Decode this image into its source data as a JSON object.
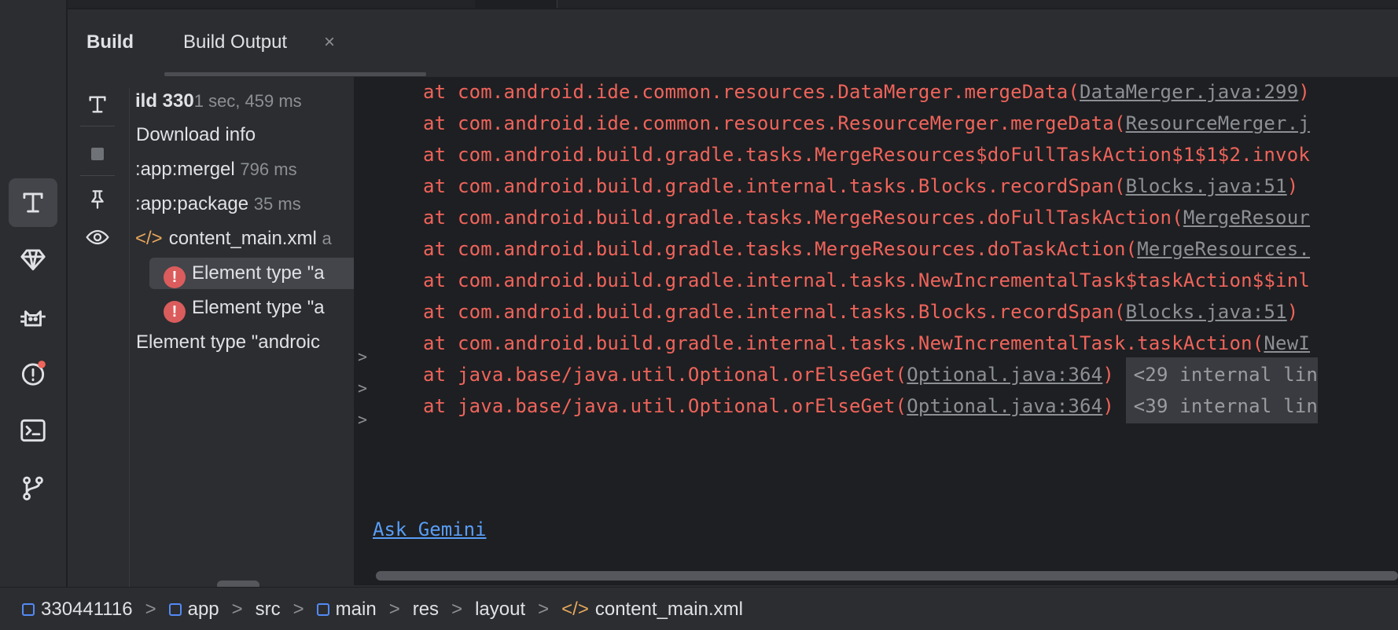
{
  "tabs": {
    "build": "Build",
    "build_output": "Build Output",
    "close": "×"
  },
  "tree": {
    "root_label": "ild 330",
    "root_time": "1 sec, 459 ms",
    "download": "Download info",
    "merge_label": ":app:mergel",
    "merge_time": "796 ms",
    "package_label": ":app:package",
    "package_time": "35 ms",
    "file_label": "content_main.xml",
    "file_suffix": "a",
    "error1": "Element type \"a",
    "error2": "Element type \"a",
    "message": "Element type \"androic"
  },
  "console": {
    "lines": [
      {
        "text": "at com.android.ide.common.resources.DataMerger.mergeData(",
        "link": "DataMerger.java:299",
        "tail": ")"
      },
      {
        "text": "at com.android.ide.common.resources.ResourceMerger.mergeData(",
        "link": "ResourceMerger.j",
        "tail": ""
      },
      {
        "text": "at com.android.build.gradle.tasks.MergeResources$doFullTaskAction$1$1$2.invok",
        "link": "",
        "tail": ""
      },
      {
        "text": "at com.android.build.gradle.internal.tasks.Blocks.recordSpan(",
        "link": "Blocks.java:51",
        "tail": ")"
      },
      {
        "text": "at com.android.build.gradle.tasks.MergeResources.doFullTaskAction(",
        "link": "MergeResour",
        "tail": ""
      },
      {
        "text": "at com.android.build.gradle.tasks.MergeResources.doTaskAction(",
        "link": "MergeResources.",
        "tail": ""
      },
      {
        "text": "at com.android.build.gradle.internal.tasks.NewIncrementalTask$taskAction$$inl",
        "link": "",
        "tail": ""
      },
      {
        "text": "at com.android.build.gradle.internal.tasks.Blocks.recordSpan(",
        "link": "Blocks.java:51",
        "tail": ")"
      },
      {
        "text": "at com.android.build.gradle.internal.tasks.NewIncrementalTask.taskAction(",
        "link": "NewI",
        "tail": ""
      },
      {
        "text": "at java.base/java.util.Optional.orElseGet(",
        "link": "Optional.java:364",
        "tail": ")",
        "internal": "<29 internal lin"
      },
      {
        "text": "at java.base/java.util.Optional.orElseGet(",
        "link": "Optional.java:364",
        "tail": ")",
        "internal": "<39 internal lin"
      }
    ],
    "fold_marker": ">",
    "ask_link": "Ask Gemini"
  },
  "statusbar": {
    "crumbs": [
      "330441116",
      "app",
      "src",
      "main",
      "res",
      "layout",
      "content_main.xml"
    ],
    "sep": ">"
  },
  "colors": {
    "error": "#f0645b",
    "link": "#589df6",
    "background": "#1e1f22",
    "panel": "#2b2d30"
  },
  "icons": [
    "build-icon",
    "gem-icon",
    "cat-icon",
    "problems-icon",
    "terminal-icon",
    "git-branch-icon",
    "pin-icon",
    "eye-icon",
    "stop-icon",
    "xml-icon",
    "error-icon",
    "module-icon"
  ]
}
